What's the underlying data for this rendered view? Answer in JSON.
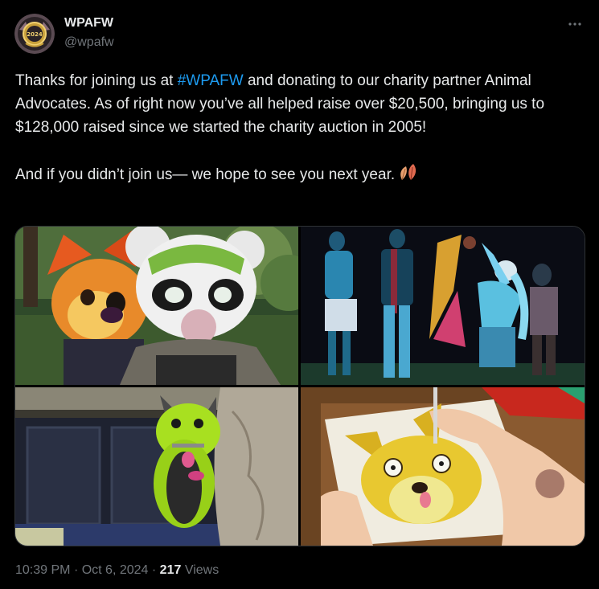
{
  "author": {
    "display_name": "WPAFW",
    "handle": "@wpafw",
    "avatar_text": "2024"
  },
  "tweet": {
    "p1_before": "Thanks for joining us at ",
    "hashtag": "#WPAFW",
    "p1_after": " and donating to our charity partner Animal Advocates. As of right now you’ve all helped raise over $20,500, bringing us to $128,000 raised since we started the charity auction in 2005!",
    "p2": "And if you didn’t join us— we hope to see you next year."
  },
  "meta": {
    "time": "10:39 PM",
    "separator": "·",
    "date": "Oct 6, 2024",
    "views_count": "217",
    "views_label": "Views"
  },
  "media": [
    {
      "subject": "costumed fox and panda characters outdoors"
    },
    {
      "subject": "dancers under blue stage lights at night"
    },
    {
      "subject": "green fuzzy costume next to stone wall"
    },
    {
      "subject": "artist drawing a yellow fox"
    }
  ],
  "icons": {
    "more": "more-horizontal-icon",
    "emoji": "leaves-emoji-icon"
  },
  "colors": {
    "background": "#000000",
    "text": "#e7e9ea",
    "secondary": "#71767b",
    "link": "#1d9bf0",
    "border": "#2f3336"
  }
}
